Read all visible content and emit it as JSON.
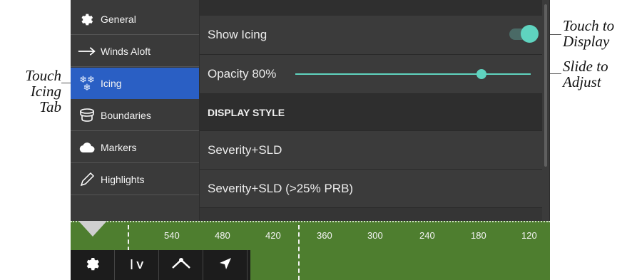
{
  "callouts": {
    "touch_icing_tab": [
      "Touch",
      "Icing Tab"
    ],
    "touch_to_display": [
      "Touch to",
      "Display"
    ],
    "slide_to_adjust": [
      "Slide to",
      "Adjust"
    ]
  },
  "sidebar": {
    "items": [
      {
        "label": "General",
        "icon": "gear-icon"
      },
      {
        "label": "Winds Aloft",
        "icon": "arrow-right-icon"
      },
      {
        "label": "Icing",
        "icon": "snowflake-icon",
        "active": true
      },
      {
        "label": "Boundaries",
        "icon": "boundary-icon"
      },
      {
        "label": "Markers",
        "icon": "cloud-icon"
      },
      {
        "label": "Highlights",
        "icon": "pencil-icon"
      }
    ]
  },
  "panel": {
    "show_icing": {
      "label": "Show Icing",
      "on": true
    },
    "opacity": {
      "label": "Opacity 80%",
      "value": 80
    },
    "display_style_header": "DISPLAY STYLE",
    "styles": [
      "Severity+SLD",
      "Severity+SLD (>25% PRB)"
    ]
  },
  "tape": {
    "labels": [
      "540",
      "480",
      "420",
      "360",
      "300",
      "240",
      "180",
      "120"
    ]
  },
  "toolbar": {
    "items": [
      {
        "icon": "gear-icon",
        "label": ""
      },
      {
        "icon": "vertical-profile-icon",
        "label": "V"
      },
      {
        "icon": "route-icon",
        "label": ""
      },
      {
        "icon": "direct-to-arrow-icon",
        "label": ""
      }
    ]
  },
  "colors": {
    "accent": "#5fd3bf",
    "active_tab": "#2a5fc4",
    "tape_green": "#4e7e2f"
  }
}
